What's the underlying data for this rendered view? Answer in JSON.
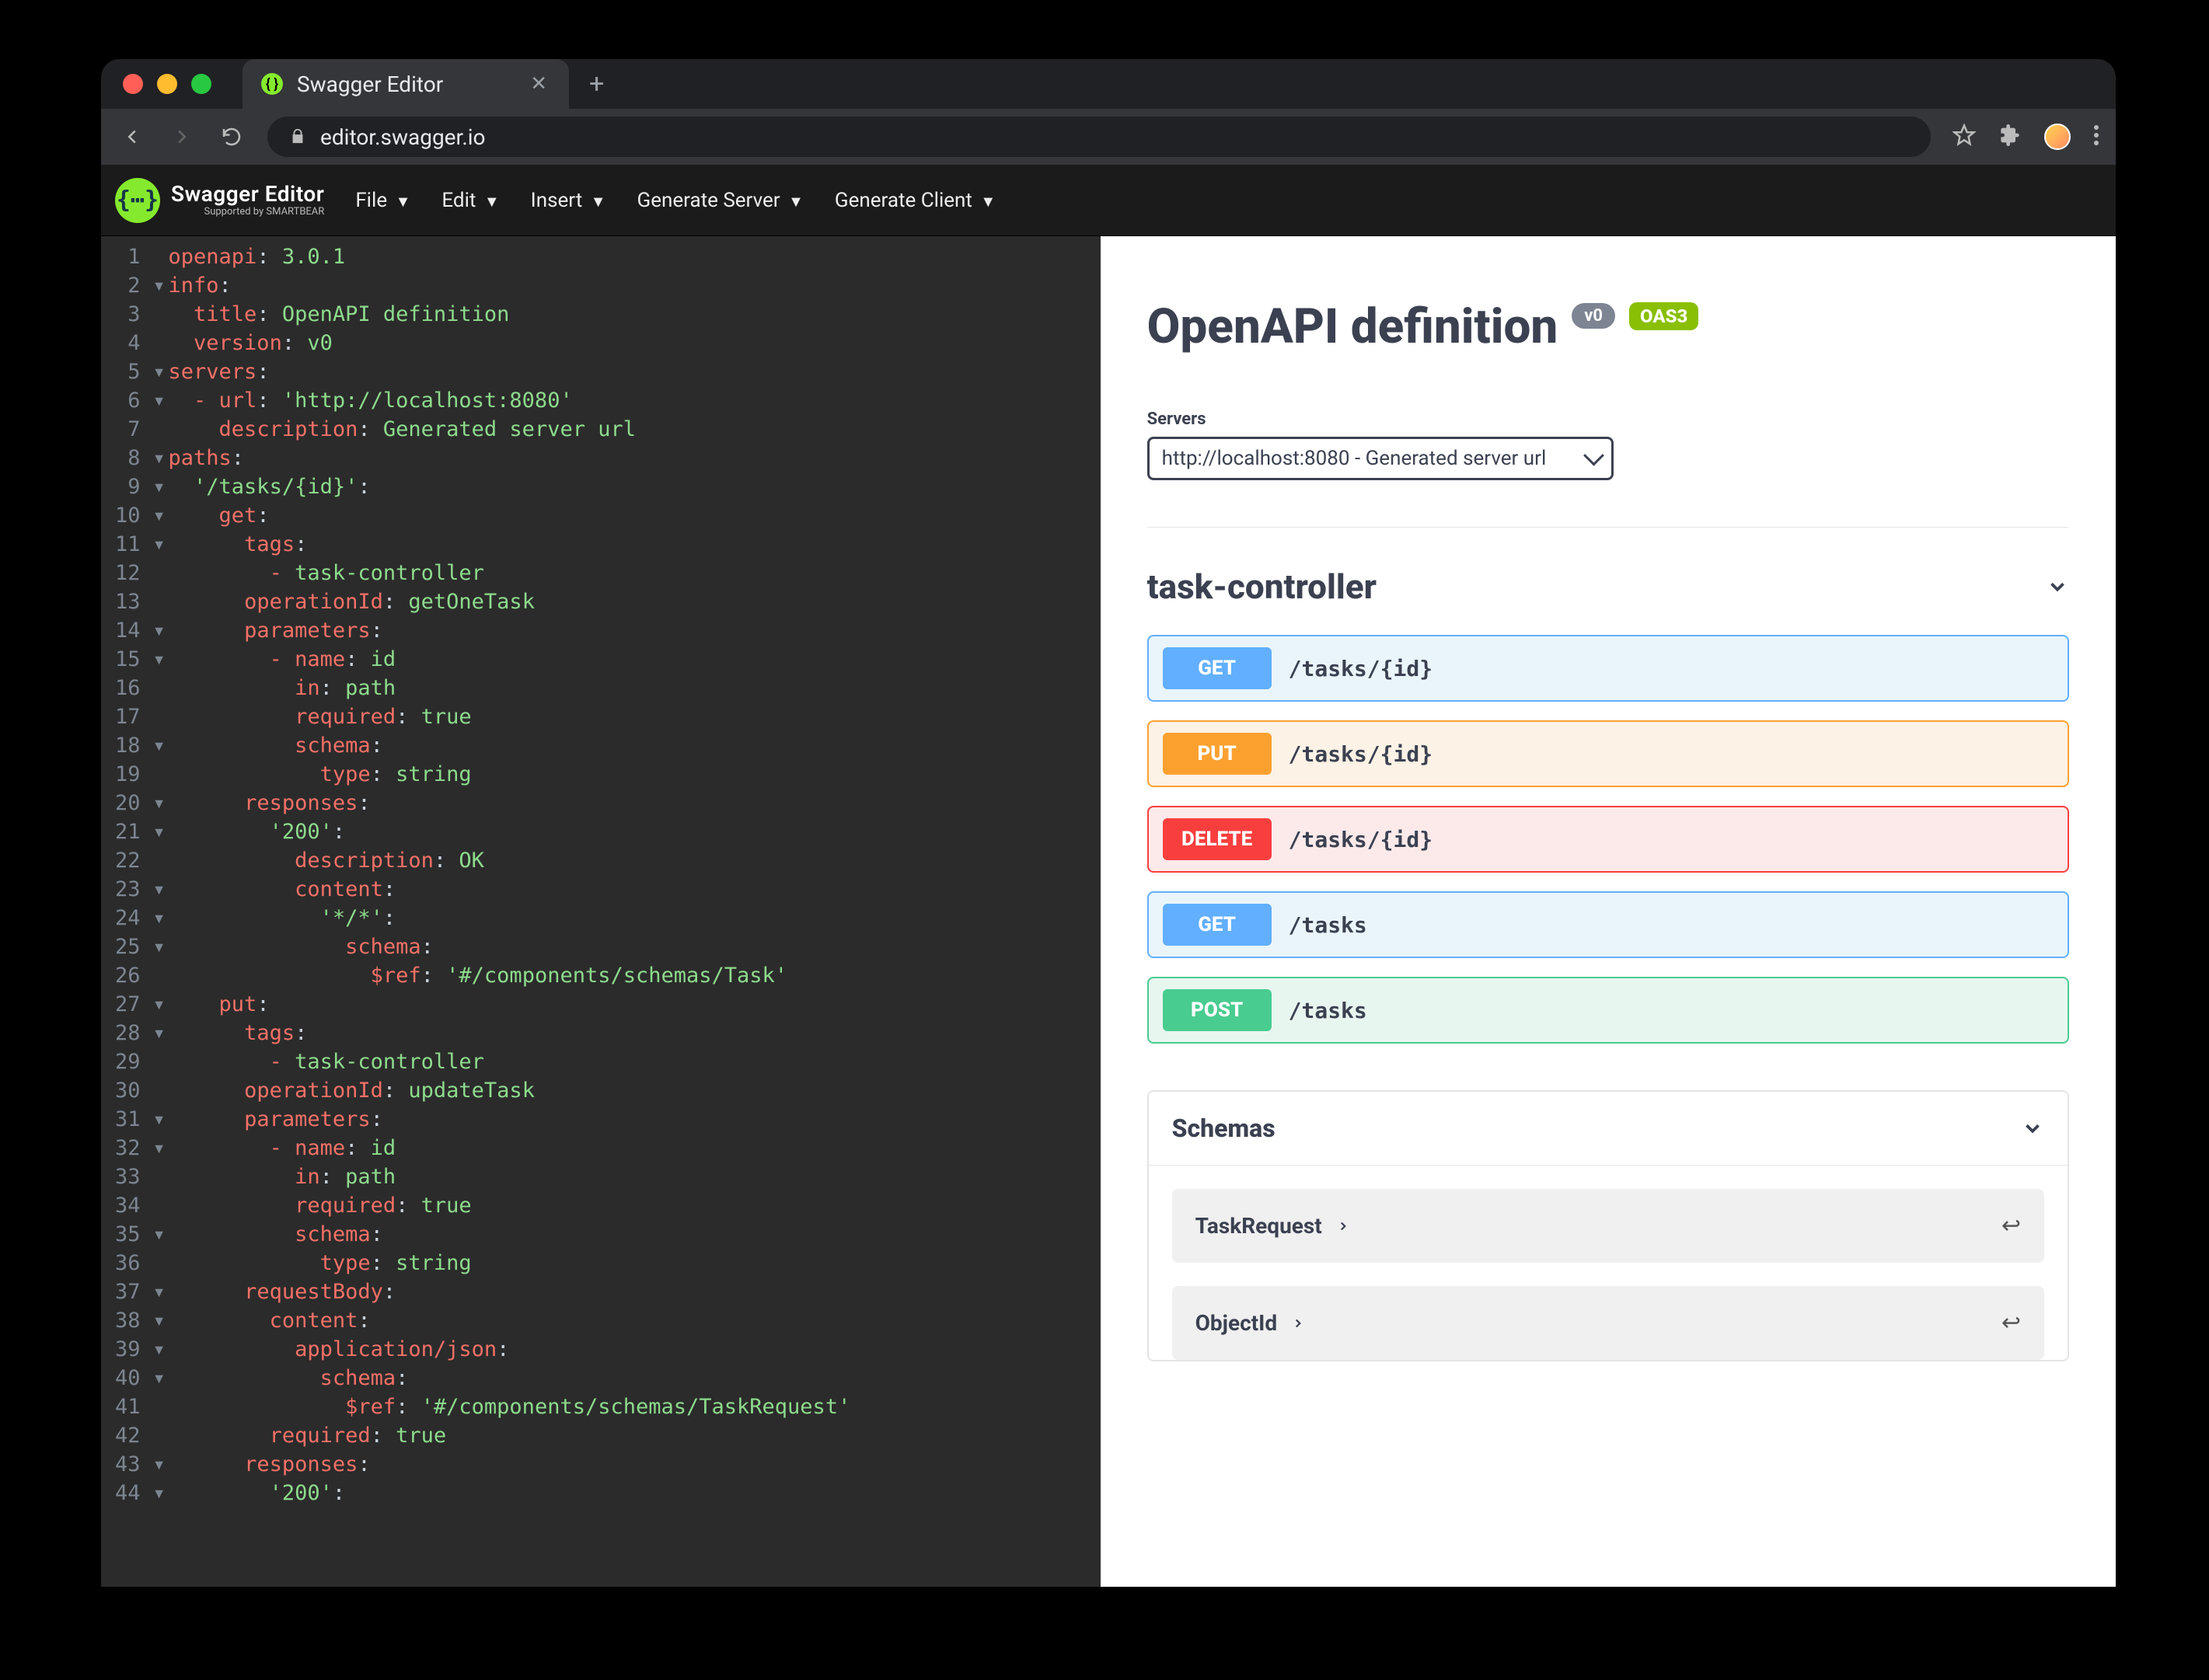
{
  "browser": {
    "tab_title": "Swagger Editor",
    "url": "editor.swagger.io"
  },
  "topbar": {
    "brand": "Swagger Editor",
    "brand_sub": "Supported by SMARTBEAR",
    "menus": {
      "file": "File",
      "edit": "Edit",
      "insert": "Insert",
      "gen_server": "Generate Server",
      "gen_client": "Generate Client"
    }
  },
  "code_lines": [
    [
      {
        "t": "key",
        "s": "openapi"
      },
      {
        "t": "plain",
        "s": ": "
      },
      {
        "t": "str",
        "s": "3.0.1"
      }
    ],
    [
      {
        "t": "fold",
        "s": "-"
      },
      {
        "t": "key",
        "s": "info"
      },
      {
        "t": "plain",
        "s": ":"
      }
    ],
    [
      {
        "t": "plain",
        "s": "  "
      },
      {
        "t": "key",
        "s": "title"
      },
      {
        "t": "plain",
        "s": ": "
      },
      {
        "t": "str",
        "s": "OpenAPI definition"
      }
    ],
    [
      {
        "t": "plain",
        "s": "  "
      },
      {
        "t": "key",
        "s": "version"
      },
      {
        "t": "plain",
        "s": ": "
      },
      {
        "t": "str",
        "s": "v0"
      }
    ],
    [
      {
        "t": "fold",
        "s": "-"
      },
      {
        "t": "key",
        "s": "servers"
      },
      {
        "t": "plain",
        "s": ":"
      }
    ],
    [
      {
        "t": "fold",
        "s": "-"
      },
      {
        "t": "plain",
        "s": "  "
      },
      {
        "t": "key",
        "s": "- url"
      },
      {
        "t": "plain",
        "s": ": "
      },
      {
        "t": "str",
        "s": "'http://localhost:8080'"
      }
    ],
    [
      {
        "t": "plain",
        "s": "    "
      },
      {
        "t": "key",
        "s": "description"
      },
      {
        "t": "plain",
        "s": ": "
      },
      {
        "t": "str",
        "s": "Generated server url"
      }
    ],
    [
      {
        "t": "fold",
        "s": "-"
      },
      {
        "t": "key",
        "s": "paths"
      },
      {
        "t": "plain",
        "s": ":"
      }
    ],
    [
      {
        "t": "fold",
        "s": "-"
      },
      {
        "t": "plain",
        "s": "  "
      },
      {
        "t": "str",
        "s": "'/tasks/{id}'"
      },
      {
        "t": "plain",
        "s": ":"
      }
    ],
    [
      {
        "t": "fold",
        "s": "-"
      },
      {
        "t": "plain",
        "s": "    "
      },
      {
        "t": "key",
        "s": "get"
      },
      {
        "t": "plain",
        "s": ":"
      }
    ],
    [
      {
        "t": "fold",
        "s": "-"
      },
      {
        "t": "plain",
        "s": "      "
      },
      {
        "t": "key",
        "s": "tags"
      },
      {
        "t": "plain",
        "s": ":"
      }
    ],
    [
      {
        "t": "plain",
        "s": "        "
      },
      {
        "t": "dash",
        "s": "- "
      },
      {
        "t": "str",
        "s": "task-controller"
      }
    ],
    [
      {
        "t": "plain",
        "s": "      "
      },
      {
        "t": "key",
        "s": "operationId"
      },
      {
        "t": "plain",
        "s": ": "
      },
      {
        "t": "str",
        "s": "getOneTask"
      }
    ],
    [
      {
        "t": "fold",
        "s": "-"
      },
      {
        "t": "plain",
        "s": "      "
      },
      {
        "t": "key",
        "s": "parameters"
      },
      {
        "t": "plain",
        "s": ":"
      }
    ],
    [
      {
        "t": "fold",
        "s": "-"
      },
      {
        "t": "plain",
        "s": "        "
      },
      {
        "t": "key",
        "s": "- name"
      },
      {
        "t": "plain",
        "s": ": "
      },
      {
        "t": "str",
        "s": "id"
      }
    ],
    [
      {
        "t": "plain",
        "s": "          "
      },
      {
        "t": "key",
        "s": "in"
      },
      {
        "t": "plain",
        "s": ": "
      },
      {
        "t": "str",
        "s": "path"
      }
    ],
    [
      {
        "t": "plain",
        "s": "          "
      },
      {
        "t": "key",
        "s": "required"
      },
      {
        "t": "plain",
        "s": ": "
      },
      {
        "t": "str",
        "s": "true"
      }
    ],
    [
      {
        "t": "fold",
        "s": "-"
      },
      {
        "t": "plain",
        "s": "          "
      },
      {
        "t": "key",
        "s": "schema"
      },
      {
        "t": "plain",
        "s": ":"
      }
    ],
    [
      {
        "t": "plain",
        "s": "            "
      },
      {
        "t": "key",
        "s": "type"
      },
      {
        "t": "plain",
        "s": ": "
      },
      {
        "t": "str",
        "s": "string"
      }
    ],
    [
      {
        "t": "fold",
        "s": "-"
      },
      {
        "t": "plain",
        "s": "      "
      },
      {
        "t": "key",
        "s": "responses"
      },
      {
        "t": "plain",
        "s": ":"
      }
    ],
    [
      {
        "t": "fold",
        "s": "-"
      },
      {
        "t": "plain",
        "s": "        "
      },
      {
        "t": "str",
        "s": "'200'"
      },
      {
        "t": "plain",
        "s": ":"
      }
    ],
    [
      {
        "t": "plain",
        "s": "          "
      },
      {
        "t": "key",
        "s": "description"
      },
      {
        "t": "plain",
        "s": ": "
      },
      {
        "t": "str",
        "s": "OK"
      }
    ],
    [
      {
        "t": "fold",
        "s": "-"
      },
      {
        "t": "plain",
        "s": "          "
      },
      {
        "t": "key",
        "s": "content"
      },
      {
        "t": "plain",
        "s": ":"
      }
    ],
    [
      {
        "t": "fold",
        "s": "-"
      },
      {
        "t": "plain",
        "s": "            "
      },
      {
        "t": "str",
        "s": "'*/*'"
      },
      {
        "t": "plain",
        "s": ":"
      }
    ],
    [
      {
        "t": "fold",
        "s": "-"
      },
      {
        "t": "plain",
        "s": "              "
      },
      {
        "t": "key",
        "s": "schema"
      },
      {
        "t": "plain",
        "s": ":"
      }
    ],
    [
      {
        "t": "plain",
        "s": "                "
      },
      {
        "t": "key",
        "s": "$ref"
      },
      {
        "t": "plain",
        "s": ": "
      },
      {
        "t": "str",
        "s": "'#/components/schemas/Task'"
      }
    ],
    [
      {
        "t": "fold",
        "s": "-"
      },
      {
        "t": "plain",
        "s": "    "
      },
      {
        "t": "key",
        "s": "put"
      },
      {
        "t": "plain",
        "s": ":"
      }
    ],
    [
      {
        "t": "fold",
        "s": "-"
      },
      {
        "t": "plain",
        "s": "      "
      },
      {
        "t": "key",
        "s": "tags"
      },
      {
        "t": "plain",
        "s": ":"
      }
    ],
    [
      {
        "t": "plain",
        "s": "        "
      },
      {
        "t": "dash",
        "s": "- "
      },
      {
        "t": "str",
        "s": "task-controller"
      }
    ],
    [
      {
        "t": "plain",
        "s": "      "
      },
      {
        "t": "key",
        "s": "operationId"
      },
      {
        "t": "plain",
        "s": ": "
      },
      {
        "t": "str",
        "s": "updateTask"
      }
    ],
    [
      {
        "t": "fold",
        "s": "-"
      },
      {
        "t": "plain",
        "s": "      "
      },
      {
        "t": "key",
        "s": "parameters"
      },
      {
        "t": "plain",
        "s": ":"
      }
    ],
    [
      {
        "t": "fold",
        "s": "-"
      },
      {
        "t": "plain",
        "s": "        "
      },
      {
        "t": "key",
        "s": "- name"
      },
      {
        "t": "plain",
        "s": ": "
      },
      {
        "t": "str",
        "s": "id"
      }
    ],
    [
      {
        "t": "plain",
        "s": "          "
      },
      {
        "t": "key",
        "s": "in"
      },
      {
        "t": "plain",
        "s": ": "
      },
      {
        "t": "str",
        "s": "path"
      }
    ],
    [
      {
        "t": "plain",
        "s": "          "
      },
      {
        "t": "key",
        "s": "required"
      },
      {
        "t": "plain",
        "s": ": "
      },
      {
        "t": "str",
        "s": "true"
      }
    ],
    [
      {
        "t": "fold",
        "s": "-"
      },
      {
        "t": "plain",
        "s": "          "
      },
      {
        "t": "key",
        "s": "schema"
      },
      {
        "t": "plain",
        "s": ":"
      }
    ],
    [
      {
        "t": "plain",
        "s": "            "
      },
      {
        "t": "key",
        "s": "type"
      },
      {
        "t": "plain",
        "s": ": "
      },
      {
        "t": "str",
        "s": "string"
      }
    ],
    [
      {
        "t": "fold",
        "s": "-"
      },
      {
        "t": "plain",
        "s": "      "
      },
      {
        "t": "key",
        "s": "requestBody"
      },
      {
        "t": "plain",
        "s": ":"
      }
    ],
    [
      {
        "t": "fold",
        "s": "-"
      },
      {
        "t": "plain",
        "s": "        "
      },
      {
        "t": "key",
        "s": "content"
      },
      {
        "t": "plain",
        "s": ":"
      }
    ],
    [
      {
        "t": "fold",
        "s": "-"
      },
      {
        "t": "plain",
        "s": "          "
      },
      {
        "t": "key",
        "s": "application/json"
      },
      {
        "t": "plain",
        "s": ":"
      }
    ],
    [
      {
        "t": "fold",
        "s": "-"
      },
      {
        "t": "plain",
        "s": "            "
      },
      {
        "t": "key",
        "s": "schema"
      },
      {
        "t": "plain",
        "s": ":"
      }
    ],
    [
      {
        "t": "plain",
        "s": "              "
      },
      {
        "t": "key",
        "s": "$ref"
      },
      {
        "t": "plain",
        "s": ": "
      },
      {
        "t": "str",
        "s": "'#/components/schemas/TaskRequest'"
      }
    ],
    [
      {
        "t": "plain",
        "s": "        "
      },
      {
        "t": "key",
        "s": "required"
      },
      {
        "t": "plain",
        "s": ": "
      },
      {
        "t": "str",
        "s": "true"
      }
    ],
    [
      {
        "t": "fold",
        "s": "-"
      },
      {
        "t": "plain",
        "s": "      "
      },
      {
        "t": "key",
        "s": "responses"
      },
      {
        "t": "plain",
        "s": ":"
      }
    ],
    [
      {
        "t": "fold",
        "s": "-"
      },
      {
        "t": "plain",
        "s": "        "
      },
      {
        "t": "str",
        "s": "'200'"
      },
      {
        "t": "plain",
        "s": ":"
      }
    ]
  ],
  "viewer": {
    "title": "OpenAPI definition",
    "version_badge": "v0",
    "oas_badge": "OAS3",
    "servers_label": "Servers",
    "server_selected": "http://localhost:8080 - Generated server url",
    "tag": "task-controller",
    "ops": [
      {
        "method": "GET",
        "class": "get",
        "path": "/tasks/{id}"
      },
      {
        "method": "PUT",
        "class": "put",
        "path": "/tasks/{id}"
      },
      {
        "method": "DELETE",
        "class": "delete",
        "path": "/tasks/{id}"
      },
      {
        "method": "GET",
        "class": "get",
        "path": "/tasks"
      },
      {
        "method": "POST",
        "class": "post",
        "path": "/tasks"
      }
    ],
    "schemas_label": "Schemas",
    "schemas": [
      "TaskRequest",
      "ObjectId"
    ]
  }
}
